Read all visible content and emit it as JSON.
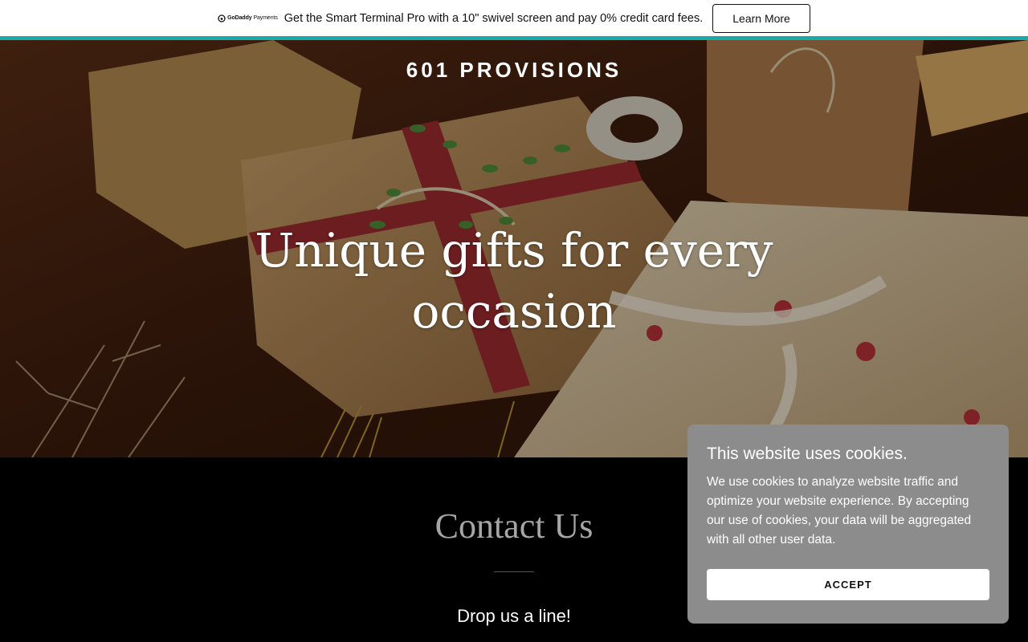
{
  "promo": {
    "logo_brand": "GoDaddy",
    "logo_product": "Payments",
    "text": "Get the Smart Terminal Pro with a 10\" swivel screen and pay 0% credit card fees.",
    "button_label": "Learn More",
    "accent_color": "#1ba9a5"
  },
  "hero": {
    "brand": "601 PROVISIONS",
    "headline": "Unique gifts for every occasion"
  },
  "contact": {
    "title": "Contact Us",
    "subtitle": "Drop us a line!"
  },
  "cookie": {
    "title": "This website uses cookies.",
    "body": "We use cookies to analyze website traffic and optimize your website experience. By accepting our use of cookies, your data will be aggregated with all other user data.",
    "accept_label": "ACCEPT"
  }
}
